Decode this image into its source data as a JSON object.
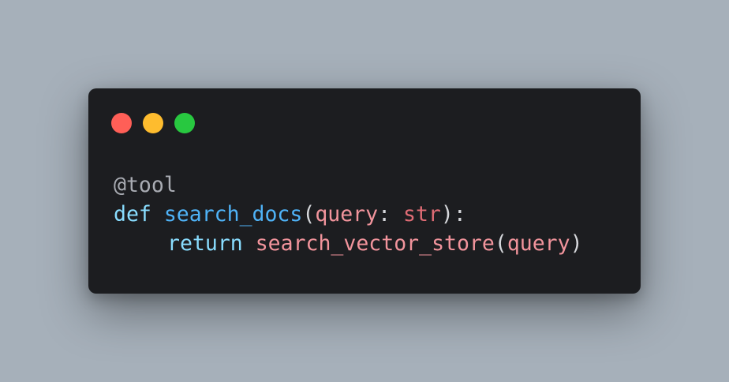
{
  "colors": {
    "background": "#a6b0ba",
    "window": "#1c1d20",
    "dot_red": "#ff5f57",
    "dot_yellow": "#febc2e",
    "dot_green": "#28c840",
    "decorator": "#a9acb3",
    "keyword": "#89ddff",
    "function": "#4fb3f7",
    "parameter": "#f2949c",
    "builtin_type": "#e06c75",
    "punctuation": "#d6d8dc"
  },
  "window_controls": [
    {
      "name": "close-dot-icon",
      "color_key": "dot_red"
    },
    {
      "name": "minimize-dot-icon",
      "color_key": "dot_yellow"
    },
    {
      "name": "maximize-dot-icon",
      "color_key": "dot_green"
    }
  ],
  "code": {
    "decorator": "@tool",
    "def_keyword": "def",
    "function_name": "search_docs",
    "open_paren": "(",
    "param_name": "query",
    "colon_space": ": ",
    "param_type": "str",
    "close_sig": "):",
    "return_keyword": "return",
    "called_function": "search_vector_store",
    "call_open": "(",
    "call_arg": "query",
    "call_close": ")"
  }
}
